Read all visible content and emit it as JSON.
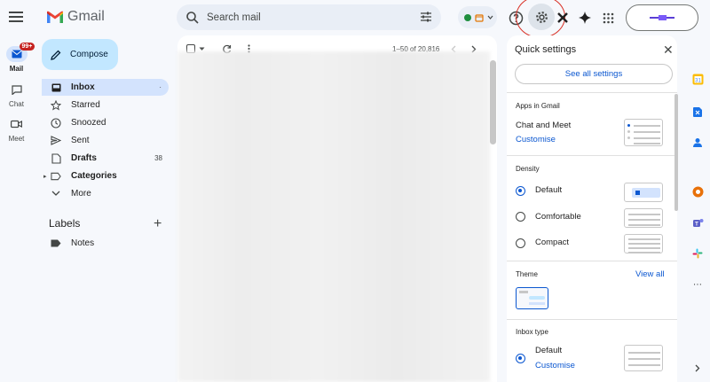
{
  "header": {
    "product_name": "Gmail",
    "search_placeholder": "Search mail",
    "status_color": "#1e8e3e"
  },
  "rail": {
    "mail_label": "Mail",
    "mail_badge": "99+",
    "chat_label": "Chat",
    "meet_label": "Meet"
  },
  "sidebar": {
    "compose_label": "Compose",
    "items": [
      {
        "label": "Inbox",
        "icon": "inbox-icon",
        "active": true
      },
      {
        "label": "Starred",
        "icon": "star-icon"
      },
      {
        "label": "Snoozed",
        "icon": "clock-icon"
      },
      {
        "label": "Sent",
        "icon": "send-icon"
      },
      {
        "label": "Drafts",
        "icon": "draft-icon",
        "count": "38"
      },
      {
        "label": "Categories",
        "icon": "label-icon"
      },
      {
        "label": "More",
        "icon": "chevron-down-icon"
      }
    ],
    "labels_heading": "Labels",
    "labels": [
      {
        "label": "Notes",
        "icon": "label-filled-icon"
      }
    ]
  },
  "mail_list": {
    "range": "1–50 of 20,816"
  },
  "quick_settings": {
    "title": "Quick settings",
    "see_all": "See all settings",
    "apps_heading": "Apps in Gmail",
    "apps_text": "Chat and Meet",
    "apps_link": "Customise",
    "density_heading": "Density",
    "density_options": [
      {
        "label": "Default",
        "selected": true
      },
      {
        "label": "Comfortable",
        "selected": false
      },
      {
        "label": "Compact",
        "selected": false
      }
    ],
    "theme_heading": "Theme",
    "theme_link": "View all",
    "inbox_type_heading": "Inbox type",
    "inbox_type_option": "Default",
    "inbox_type_link": "Customise"
  },
  "colors": {
    "accent": "#0b57d0",
    "compose_bg": "#c2e7ff",
    "active_nav": "#d3e3fd",
    "badge": "#c5221f",
    "annotation_circle": "#d93025"
  }
}
